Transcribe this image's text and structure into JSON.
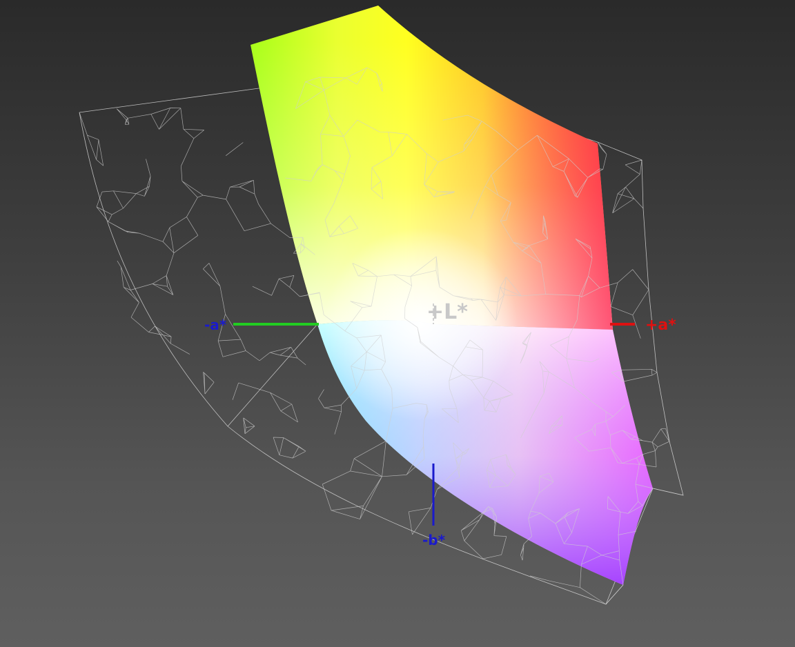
{
  "axes": {
    "plus_a": {
      "label": "+a*",
      "color": "#e01010"
    },
    "minus_a": {
      "label": "-a*",
      "color": "#1a1acc"
    },
    "minus_b": {
      "label": "-b*",
      "color": "#1a1acc"
    },
    "plus_l": {
      "label": "+L*",
      "color": "#c8c8c8"
    }
  },
  "colors": {
    "background_top": "#2a2a2a",
    "background_bottom": "#5f5f5f",
    "wireframe": "#d8d8d8",
    "green_axis": "#22cc22",
    "red_axis": "#dd1111",
    "blue_axis": "#1a1acc"
  }
}
